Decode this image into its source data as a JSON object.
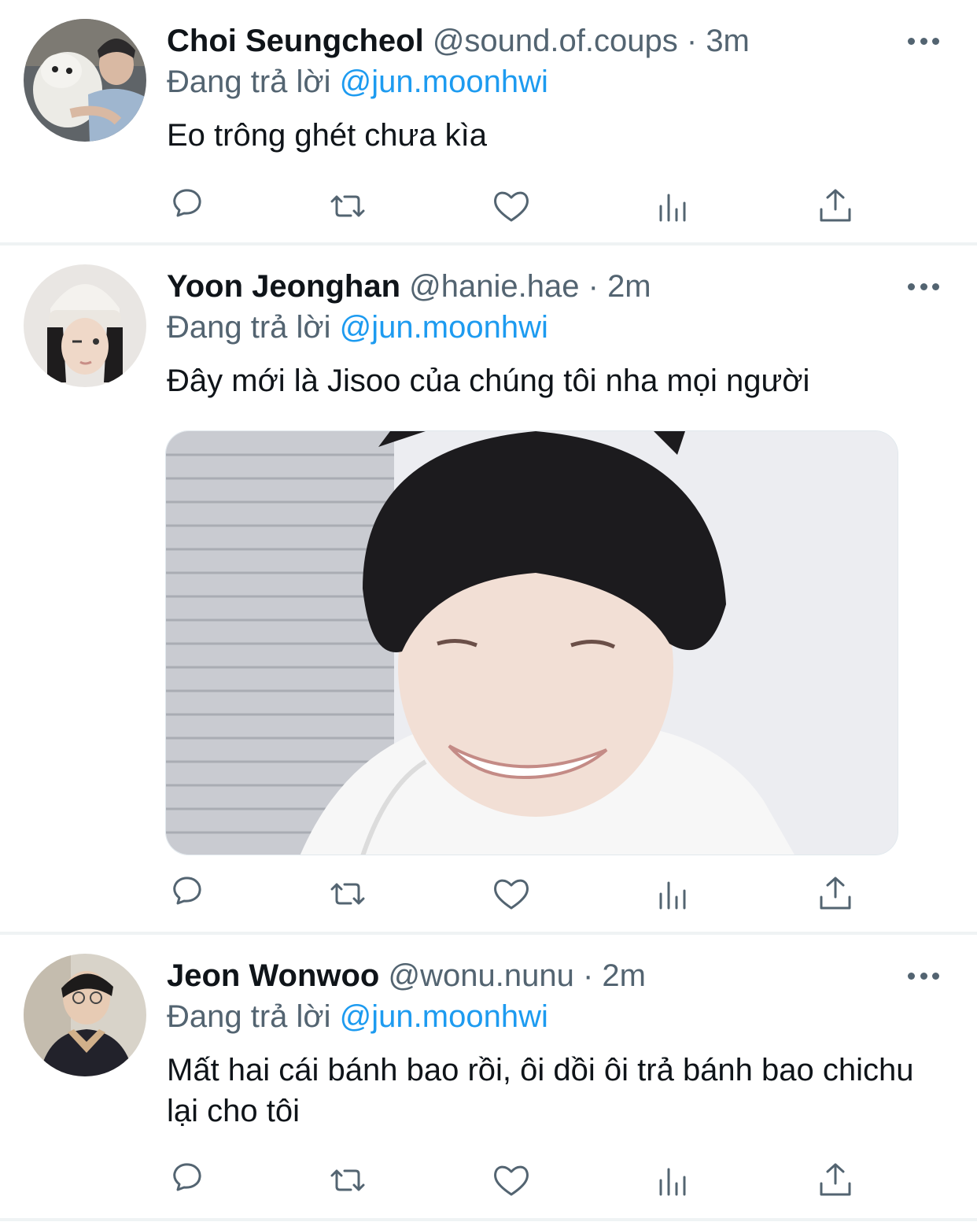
{
  "tweets": [
    {
      "name": "Choi Seungcheol",
      "handle": "@sound.of.coups",
      "dot": "·",
      "time": "3m",
      "reply_prefix": "Đang trả lời",
      "reply_to": "@jun.moonhwi",
      "text": "Eo trông ghét chưa kìa"
    },
    {
      "name": "Yoon Jeonghan",
      "handle": "@hanie.hae",
      "dot": "·",
      "time": "2m",
      "reply_prefix": "Đang trả lời",
      "reply_to": "@jun.moonhwi",
      "text": "Đây mới là Jisoo của chúng tôi nha mọi người"
    },
    {
      "name": "Jeon Wonwoo",
      "handle": "@wonu.nunu",
      "dot": "·",
      "time": "2m",
      "reply_prefix": "Đang trả lời",
      "reply_to": "@jun.moonhwi",
      "text": "Mất hai cái bánh bao rồi, ôi dồi ôi trả bánh bao chichu lại cho tôi"
    }
  ],
  "icons": {
    "reply": "reply-icon",
    "retweet": "retweet-icon",
    "like": "heart-icon",
    "views": "views-icon",
    "share": "share-icon",
    "more": "more-icon"
  },
  "colors": {
    "accent": "#1d9bf0",
    "secondary_text": "#536471",
    "divider": "#eff3f4"
  }
}
